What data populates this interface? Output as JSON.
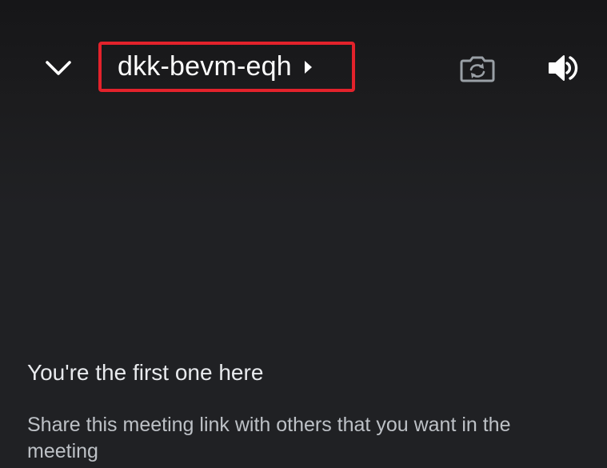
{
  "header": {
    "collapse_icon": "chevron-down-icon",
    "meeting_code": "dkk-bevm-eqh",
    "meeting_code_caret_icon": "caret-right-icon",
    "switch_camera_icon": "camera-switch-icon",
    "audio_output_icon": "speaker-icon",
    "highlight_color": "#e3222b"
  },
  "main": {
    "title": "You're the first one here",
    "description": "Share this meeting link with others that you want in the meeting"
  }
}
